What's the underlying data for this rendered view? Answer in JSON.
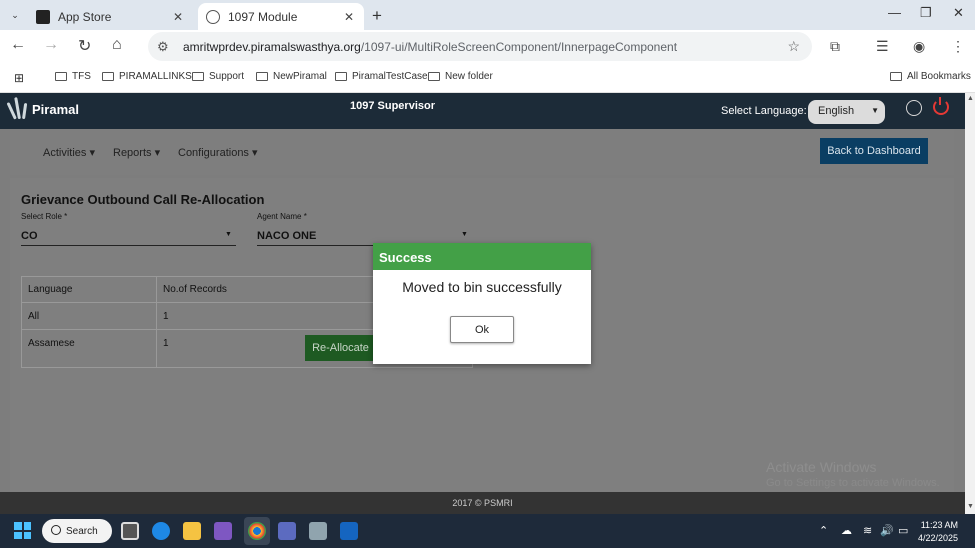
{
  "browser": {
    "tabs": [
      {
        "title": "App Store",
        "active": false
      },
      {
        "title": "1097 Module",
        "active": true
      }
    ],
    "url_host": "amritwprdev.piramalswasthya.org",
    "url_path": "/1097-ui/MultiRoleScreenComponent/InnerpageComponent",
    "bookmarks": [
      "TFS",
      "PIRAMALLINKS",
      "Support",
      "NewPiramal",
      "PiramalTestCase",
      "New folder"
    ],
    "all_bookmarks": "All Bookmarks"
  },
  "header": {
    "logo_text": "Piramal",
    "app_title": "1097 Supervisor",
    "language_label": "Select Language:",
    "language_value": "English"
  },
  "nav": {
    "menus": [
      "Activities",
      "Reports",
      "Configurations"
    ],
    "back_button": "Back to Dashboard"
  },
  "page": {
    "title": "Grievance Outbound Call Re-Allocation",
    "role_label": "Select Role *",
    "role_value": "CO",
    "agent_label": "Agent Name *",
    "agent_value": "NACO ONE",
    "table": {
      "headers": [
        "Language",
        "No.of Records"
      ],
      "rows": [
        [
          "All",
          "1"
        ],
        [
          "Assamese",
          "1"
        ]
      ]
    },
    "reallocate_button": "Re-Allocate"
  },
  "dialog": {
    "title": "Success",
    "message": "Moved to bin successfully",
    "ok_label": "Ok"
  },
  "watermark": {
    "line1": "Activate Windows",
    "line2": "Go to Settings to activate Windows."
  },
  "footer": "2017 © PSMRI",
  "taskbar": {
    "search_label": "Search",
    "time": "11:23 AM",
    "date": "4/22/2025"
  },
  "colors": {
    "header_bg": "#1c2b38",
    "success_green": "#43a047",
    "back_button": "#0a3e63",
    "reallocate_button": "#1e5a22"
  }
}
